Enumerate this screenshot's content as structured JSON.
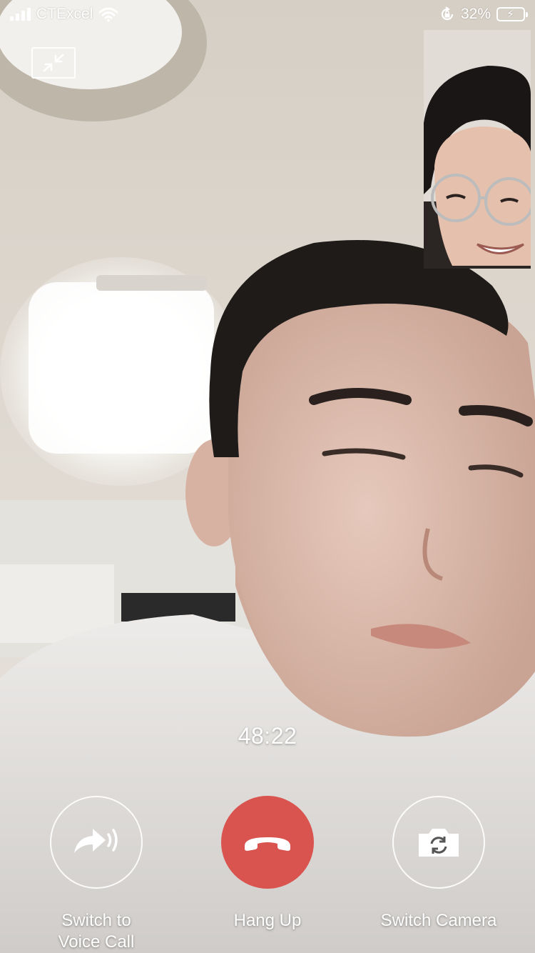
{
  "status_bar": {
    "carrier": "CTExcel",
    "battery_percent": "32%",
    "battery_level": 0.32,
    "charging": true,
    "rotation_lock": true
  },
  "call": {
    "duration": "48:22"
  },
  "controls": {
    "voice_call_label_line1": "Switch to",
    "voice_call_label_line2": "Voice Call",
    "hang_up_label": "Hang Up",
    "switch_camera_label": "Switch Camera"
  },
  "icons": {
    "minimize": "minimize-video-icon",
    "voice": "switch-to-voice-icon",
    "hangup": "hang-up-icon",
    "camera": "switch-camera-icon",
    "wifi": "wifi-icon",
    "signal": "signal-strength-icon",
    "rotation_lock": "rotation-lock-icon",
    "battery": "battery-icon"
  },
  "colors": {
    "hang_up": "#d9534f",
    "battery_fill": "#f4d23d"
  }
}
